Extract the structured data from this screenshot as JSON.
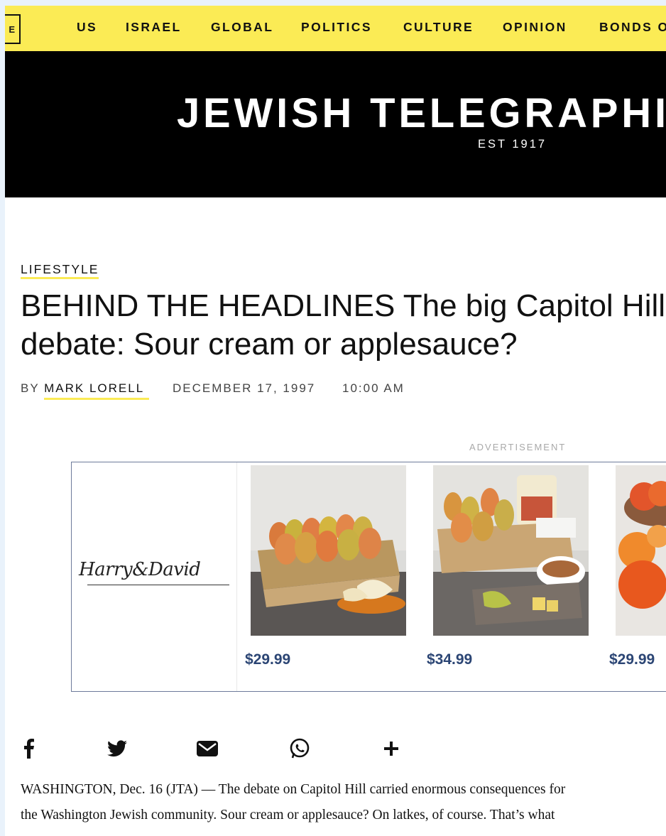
{
  "nav": {
    "menu_label": "E",
    "items": [
      {
        "label": "US"
      },
      {
        "label": "ISRAEL"
      },
      {
        "label": "GLOBAL"
      },
      {
        "label": "POLITICS"
      },
      {
        "label": "CULTURE"
      },
      {
        "label": "OPINION"
      },
      {
        "label": "BONDS O"
      }
    ]
  },
  "masthead": {
    "title": "JEWISH TELEGRAPHIC",
    "established": "EST 1917"
  },
  "article": {
    "category": "LIFESTYLE",
    "headline": "BEHIND THE HEADLINES The big Capitol Hill debate: Sour cream or applesauce?",
    "byline_prefix": "BY",
    "author": "MARK LORELL",
    "date": "DECEMBER 17, 1997",
    "time": "10:00 AM",
    "body": [
      "WASHINGTON, Dec. 16 (JTA) — The debate on Capitol Hill carried enormous consequences for",
      "the Washington Jewish community. Sour cream or applesauce? On latkes, of course. That’s what"
    ]
  },
  "ad": {
    "label": "ADVERTISEMENT",
    "brand": "Harry&David",
    "products": [
      {
        "price": "$29.99"
      },
      {
        "price": "$34.99"
      },
      {
        "price": "$29.99"
      }
    ]
  },
  "share": {
    "icons": [
      "facebook-icon",
      "twitter-icon",
      "email-icon",
      "whatsapp-icon",
      "plus-icon"
    ]
  },
  "colors": {
    "nav_background": "#fbeb55",
    "masthead_background": "#000000",
    "price_color": "#2b4574",
    "ad_border": "#6d7a9a"
  }
}
